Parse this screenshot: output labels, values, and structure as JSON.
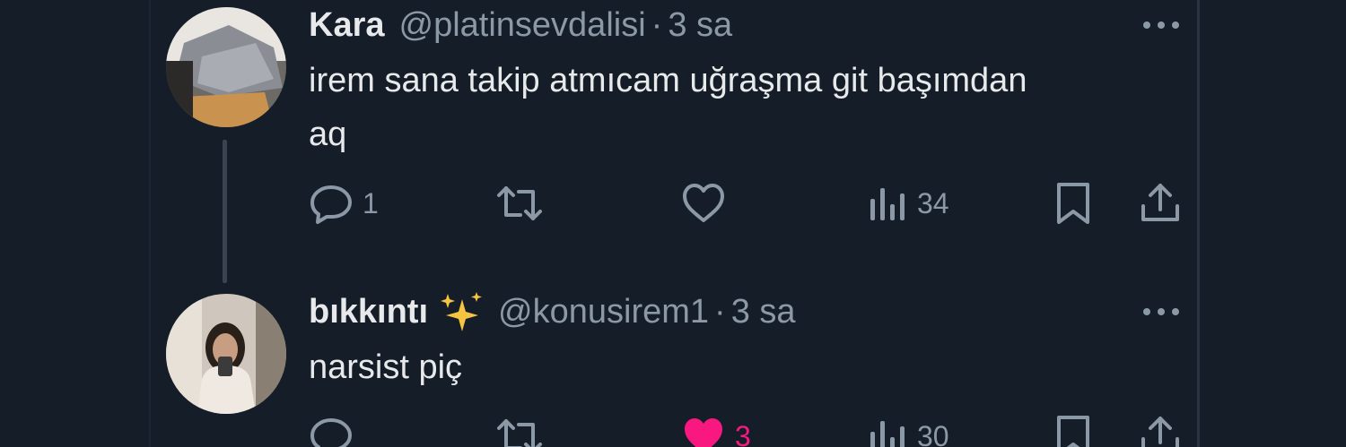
{
  "tweets": [
    {
      "name": "Kara",
      "handle": "@platinsevdalisi",
      "separator": "·",
      "time": "3 sa",
      "text": "irem sana takip atmıcam uğraşma git başımdan\naq",
      "actions": {
        "reply_icon": "reply-icon",
        "reply_count": "1",
        "retweet_icon": "retweet-icon",
        "retweet_count": "",
        "like_icon": "heart-outline-icon",
        "like_count": "",
        "views_icon": "views-icon",
        "views_count": "34",
        "bookmark_icon": "bookmark-icon",
        "share_icon": "share-icon"
      },
      "liked": false
    },
    {
      "name": "bıkkıntı",
      "name_emoji": "sparkles-icon",
      "handle": "@konusirem1",
      "separator": "·",
      "time": "3 sa",
      "text": "narsist piç",
      "actions": {
        "reply_icon": "reply-icon",
        "reply_count": "",
        "retweet_icon": "retweet-icon",
        "retweet_count": "",
        "like_icon": "heart-filled-icon",
        "like_count": "3",
        "views_icon": "views-icon",
        "views_count": "30",
        "bookmark_icon": "bookmark-icon",
        "share_icon": "share-icon"
      },
      "liked": true
    }
  ],
  "colors": {
    "background": "#151d28",
    "text_primary": "#e7e9ea",
    "text_secondary": "#8b98a5",
    "like_active": "#f91880",
    "sparkle": "#f5c542"
  }
}
